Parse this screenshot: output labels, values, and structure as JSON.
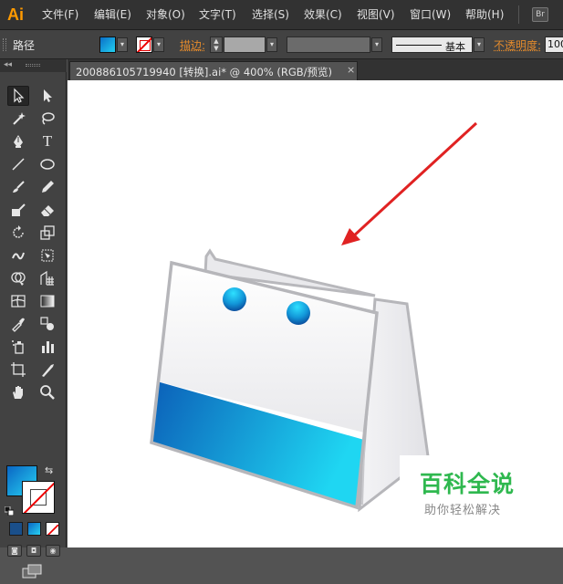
{
  "app": {
    "logo": "Ai",
    "bridge_button": "Br"
  },
  "menu": [
    "文件(F)",
    "编辑(E)",
    "对象(O)",
    "文字(T)",
    "选择(S)",
    "效果(C)",
    "视图(V)",
    "窗口(W)",
    "帮助(H)"
  ],
  "control_bar": {
    "selection_type": "路径",
    "stroke_label": "描边:",
    "stroke_profile": "基本",
    "opacity_label": "不透明度:",
    "opacity_value": "100"
  },
  "document_tab": {
    "title": "200886105719940  [转换].ai* @ 400% (RGB/预览)",
    "close": "×"
  },
  "toolbox": {
    "tools": [
      "selection-tool",
      "direct-selection-tool",
      "magic-wand-tool",
      "lasso-tool",
      "pen-tool",
      "type-tool",
      "line-tool",
      "ellipse-tool",
      "paintbrush-tool",
      "pencil-tool",
      "blob-brush-tool",
      "eraser-tool",
      "rotate-tool",
      "scale-tool",
      "warp-tool",
      "free-transform-tool",
      "shape-builder-tool",
      "perspective-grid-tool",
      "mesh-tool",
      "gradient-tool",
      "eyedropper-tool",
      "blend-tool",
      "symbol-sprayer-tool",
      "column-graph-tool",
      "artboard-tool",
      "slice-tool",
      "hand-tool",
      "zoom-tool"
    ],
    "fill_colors": [
      "#0a66c4",
      "#27d2f2"
    ],
    "stroke_color": "none"
  },
  "colors": {
    "accent_orange": "#ff9a00",
    "arrow_red": "#e02222",
    "bag_gradient_start": "#0b5fb8",
    "bag_gradient_end": "#1fd6f2",
    "watermark_green": "#2fb84f"
  },
  "watermark": {
    "title": "百科全说",
    "subtitle": "助你轻松解决"
  }
}
